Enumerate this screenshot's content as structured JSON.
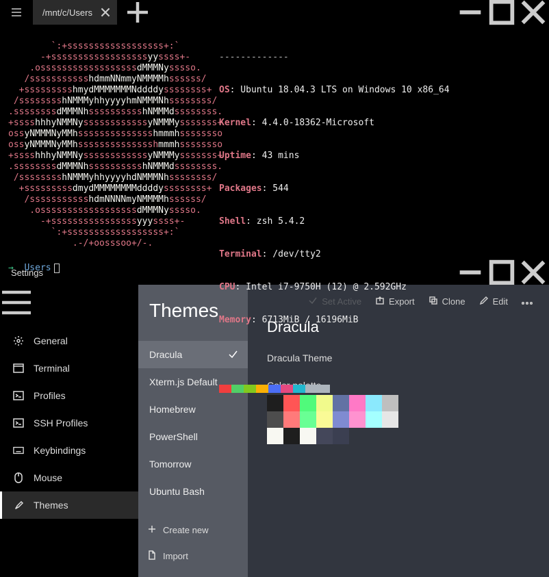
{
  "titlebar": {
    "tab_title": "/mnt/c/Users"
  },
  "terminal": {
    "prompt_path": "Users",
    "neofetch": {
      "dashes": "-------------",
      "os_label": "OS",
      "os_val": ": Ubuntu 18.04.3 LTS on Windows 10 x86_64",
      "kernel_label": "Kernel",
      "kernel_val": ": 4.4.0-18362-Microsoft",
      "uptime_label": "Uptime",
      "uptime_val": ": 43 mins",
      "packages_label": "Packages",
      "packages_val": ": 544",
      "shell_label": "Shell",
      "shell_val": ": zsh 5.4.2",
      "terminal_label": "Terminal",
      "terminal_val": ": /dev/tty2",
      "cpu_label": "CPU",
      "cpu_val": ": Intel i7-9750H (12) @ 2.592GHz",
      "memory_label": "Memory",
      "memory_val": ": 6713MiB / 16196MiB",
      "colors": [
        "#f03e3e",
        "#51cf66",
        "#82c91e",
        "#fab005",
        "#4c6ef5",
        "#e64980",
        "#22b8cf",
        "#adb5bd",
        "#adb5bd"
      ]
    }
  },
  "settings": {
    "title": "Settings",
    "sidebar": {
      "items": [
        {
          "icon": "gear-icon",
          "label": "General"
        },
        {
          "icon": "window-icon",
          "label": "Terminal"
        },
        {
          "icon": "shell-icon",
          "label": "Profiles"
        },
        {
          "icon": "shell-icon",
          "label": "SSH Profiles"
        },
        {
          "icon": "keyboard-icon",
          "label": "Keybindings"
        },
        {
          "icon": "mouse-icon",
          "label": "Mouse"
        },
        {
          "icon": "brush-icon",
          "label": "Themes"
        }
      ],
      "active_index": 6
    },
    "themes": {
      "heading": "Themes",
      "list": [
        "Dracula",
        "Xterm.js Default",
        "Homebrew",
        "PowerShell",
        "Tomorrow",
        "Ubuntu Bash"
      ],
      "selected_index": 0,
      "create_label": "Create new",
      "import_label": "Import"
    },
    "toolbar": {
      "set_active": "Set Active",
      "export": "Export",
      "clone": "Clone",
      "edit": "Edit"
    },
    "detail": {
      "name": "Dracula",
      "subtitle": "Dracula Theme",
      "palette_label": "Color palette",
      "palette": [
        "#1e1e1e",
        "#ff5555",
        "#50fa7b",
        "#f1fa8c",
        "#6272a4",
        "#ff79c6",
        "#8be9fd",
        "#bfbfbf",
        "#4d4d4d",
        "#ff7a7a",
        "#69ff94",
        "#fafa96",
        "#7f8bd1",
        "#ff92d0",
        "#a4ffff",
        "#e6e6e6",
        "#f8f8f2",
        "#1e1e1e",
        "#f8f8f2",
        "#44475a",
        "#3b3f51"
      ]
    }
  }
}
